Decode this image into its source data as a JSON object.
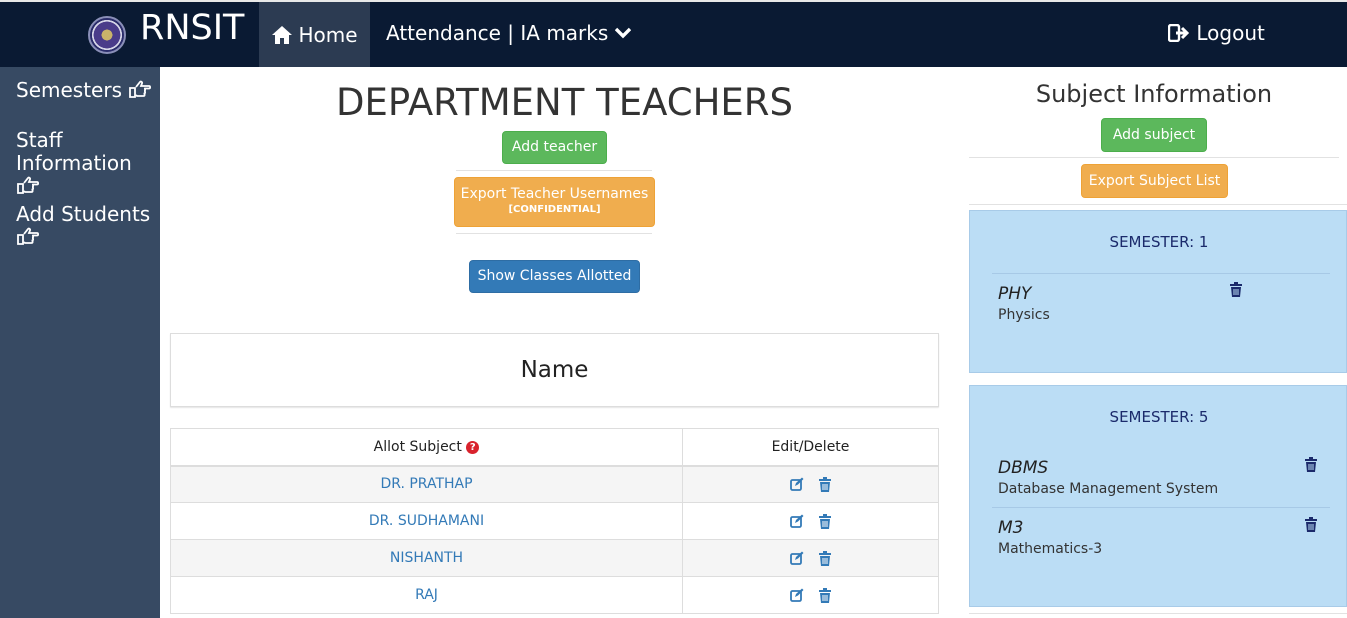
{
  "header": {
    "brand": "RNSIT",
    "home_label": "Home",
    "attendance_label": "Attendance | IA marks",
    "logout_label": "Logout"
  },
  "sidebar": {
    "items": [
      {
        "label": "Semesters"
      },
      {
        "label": "Staff Information"
      },
      {
        "label": "Add Students"
      }
    ]
  },
  "main": {
    "title": "DEPARTMENT TEACHERS",
    "add_teacher_label": "Add teacher",
    "export_label": "Export Teacher Usernames",
    "export_sub_label": "[CONFIDENTIAL]",
    "show_classes_label": "Show Classes Allotted",
    "name_header": "Name",
    "table": {
      "columns": [
        "Allot Subject",
        "Edit/Delete"
      ],
      "rows": [
        "DR. PRATHAP",
        "DR. SUDHAMANI",
        "NISHANTH",
        "RAJ"
      ]
    }
  },
  "subjects": {
    "title": "Subject Information",
    "add_subject_label": "Add subject",
    "export_list_label": "Export Subject List",
    "semesters": [
      {
        "label": "SEMESTER: 1",
        "subjects": [
          {
            "code": "PHY",
            "name": "Physics"
          }
        ]
      },
      {
        "label": "SEMESTER: 5",
        "subjects": [
          {
            "code": "DBMS",
            "name": "Database Management System"
          },
          {
            "code": "M3",
            "name": "Mathematics-3"
          }
        ]
      }
    ]
  },
  "colors": {
    "navbar": "#0a1a33",
    "sidebar": "#374a63",
    "success": "#5cb85c",
    "warning": "#f0ad4e",
    "primary": "#337ab7",
    "semester_card": "#bbddf5"
  }
}
